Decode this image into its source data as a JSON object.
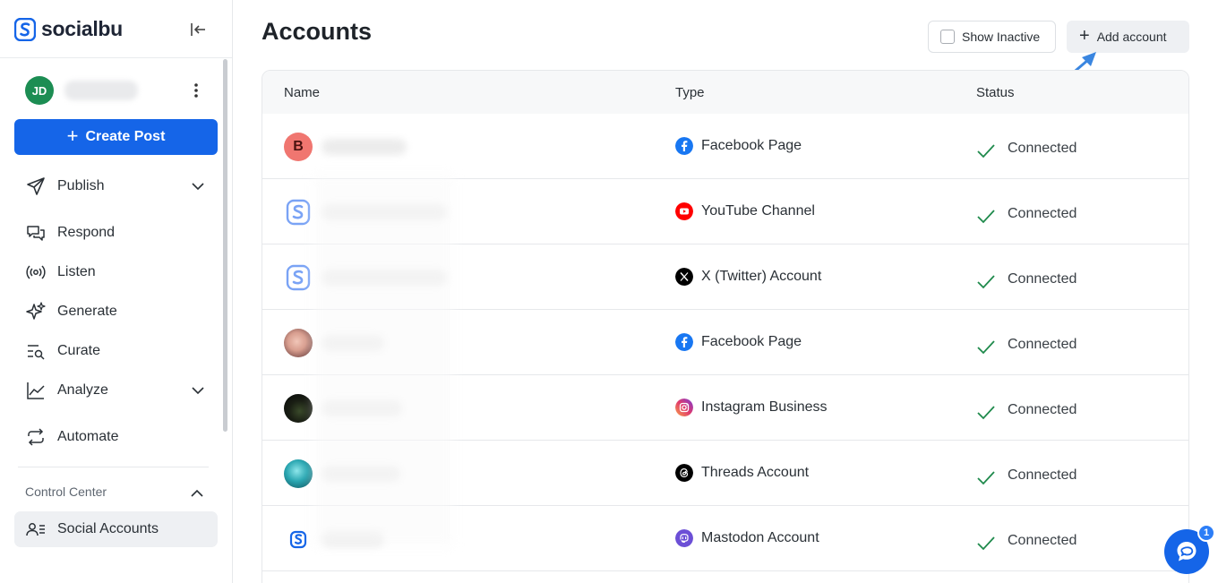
{
  "app": {
    "brand": "socialbu",
    "accent_color": "#1565e8"
  },
  "user": {
    "initials": "JD",
    "avatar_color": "#1c8d53"
  },
  "sidebar": {
    "create_post_label": "Create Post",
    "items": [
      {
        "label": "Publish",
        "icon": "paper-plane-icon",
        "has_chevron": true
      },
      {
        "label": "Respond",
        "icon": "chat-bubbles-icon",
        "has_chevron": false
      },
      {
        "label": "Listen",
        "icon": "broadcast-icon",
        "has_chevron": false
      },
      {
        "label": "Generate",
        "icon": "sparkle-icon",
        "has_chevron": false
      },
      {
        "label": "Curate",
        "icon": "list-search-icon",
        "has_chevron": false
      },
      {
        "label": "Analyze",
        "icon": "line-chart-icon",
        "has_chevron": true
      },
      {
        "label": "Automate",
        "icon": "repeat-icon",
        "has_chevron": false
      }
    ],
    "control_center_label": "Control Center",
    "social_accounts_label": "Social Accounts"
  },
  "header": {
    "title": "Accounts",
    "show_inactive_label": "Show Inactive",
    "show_inactive_checked": false,
    "add_account_label": "Add account"
  },
  "table": {
    "columns": [
      "Name",
      "Type",
      "Status"
    ],
    "rows": [
      {
        "avatar": "letter-b-avatar",
        "avatar_letter": "B",
        "type": "Facebook Page",
        "network_icon": "facebook-icon",
        "status": "Connected"
      },
      {
        "avatar": "socialbu-logo-avatar",
        "type": "YouTube Channel",
        "network_icon": "youtube-icon",
        "status": "Connected"
      },
      {
        "avatar": "socialbu-logo-avatar",
        "type": "X (Twitter) Account",
        "network_icon": "x-twitter-icon",
        "status": "Connected"
      },
      {
        "avatar": "portrait-photo-avatar",
        "type": "Facebook Page",
        "network_icon": "facebook-icon",
        "status": "Connected"
      },
      {
        "avatar": "night-photo-avatar",
        "type": "Instagram Business",
        "network_icon": "instagram-icon",
        "status": "Connected"
      },
      {
        "avatar": "teal-photo-avatar",
        "type": "Threads Account",
        "network_icon": "threads-icon",
        "status": "Connected"
      },
      {
        "avatar": "socialbu-small-avatar",
        "type": "Mastodon Account",
        "network_icon": "mastodon-icon",
        "status": "Connected"
      }
    ]
  },
  "chat_widget": {
    "badge_count": "1"
  }
}
